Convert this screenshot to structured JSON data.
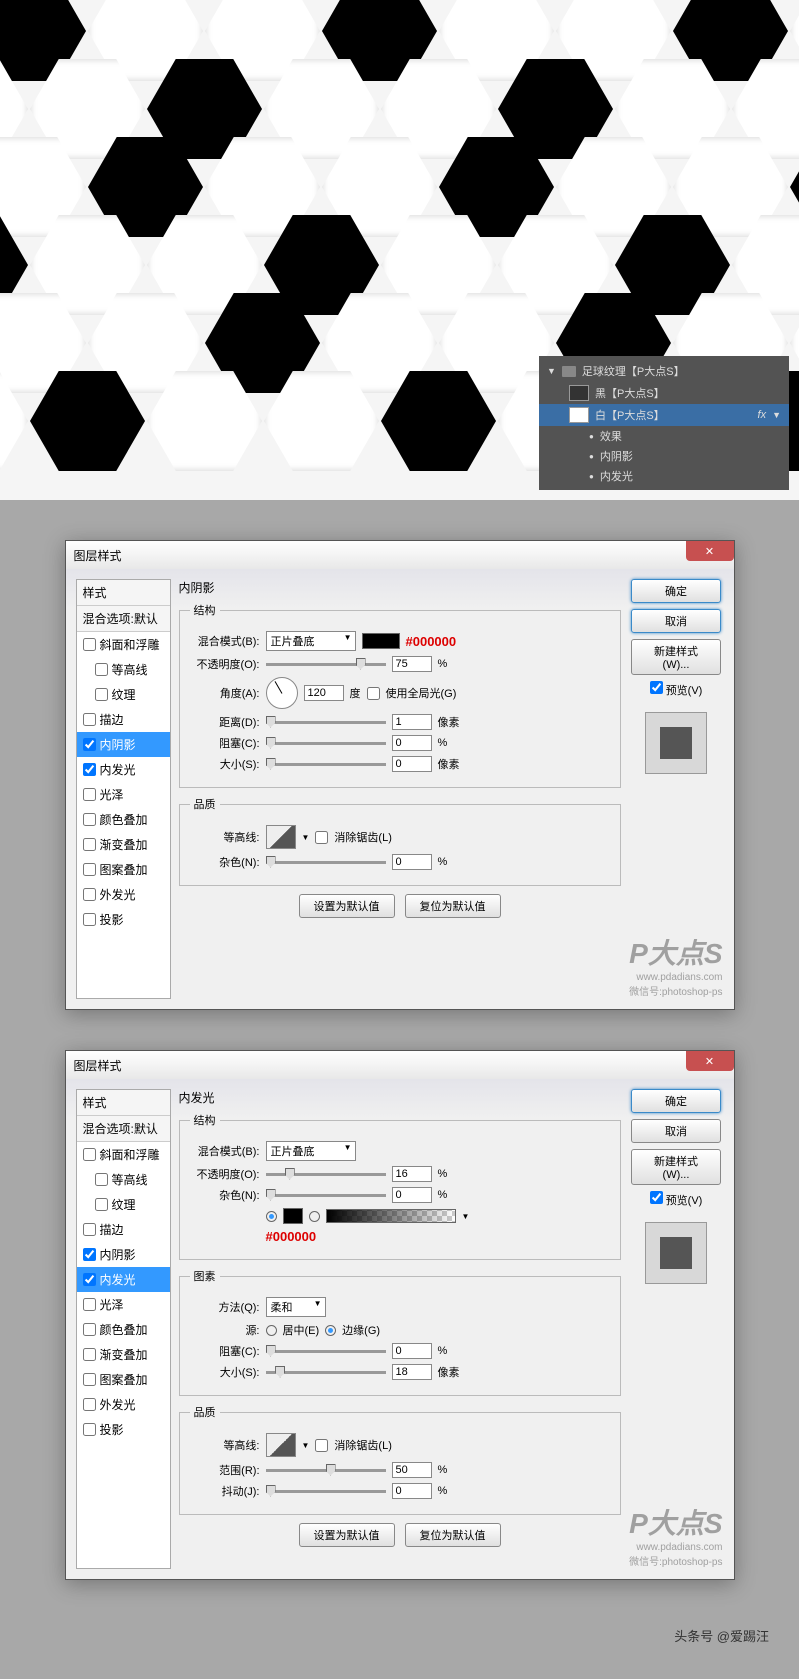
{
  "layers": {
    "group": "足球纹理【P大点S】",
    "black": "黑【P大点S】",
    "white": "白【P大点S】",
    "fx_label": "fx",
    "effects": "效果",
    "effect_inner_shadow": "内阴影",
    "effect_inner_glow": "内发光"
  },
  "dialog": {
    "title": "图层样式",
    "close": "✕",
    "ok": "确定",
    "cancel": "取消",
    "new_style": "新建样式(W)...",
    "preview": "预览(V)",
    "set_default": "设置为默认值",
    "reset_default": "复位为默认值"
  },
  "styles_list": {
    "header": "样式",
    "blend_default": "混合选项:默认",
    "bevel": "斜面和浮雕",
    "contour": "等高线",
    "texture": "纹理",
    "stroke": "描边",
    "inner_shadow": "内阴影",
    "inner_glow": "内发光",
    "satin": "光泽",
    "color_overlay": "颜色叠加",
    "gradient_overlay": "渐变叠加",
    "pattern_overlay": "图案叠加",
    "outer_glow": "外发光",
    "drop_shadow": "投影"
  },
  "d1": {
    "title": "内阴影",
    "structure": "结构",
    "blend_mode_label": "混合模式(B):",
    "blend_mode_value": "正片叠底",
    "color_hex": "#000000",
    "opacity_label": "不透明度(O):",
    "opacity_value": "75",
    "angle_label": "角度(A):",
    "angle_value": "120",
    "angle_unit": "度",
    "global_light": "使用全局光(G)",
    "distance_label": "距离(D):",
    "distance_value": "1",
    "px": "像素",
    "choke_label": "阻塞(C):",
    "choke_value": "0",
    "size_label": "大小(S):",
    "size_value": "0",
    "quality": "品质",
    "contour_label": "等高线:",
    "antialias": "消除锯齿(L)",
    "noise_label": "杂色(N):",
    "noise_value": "0",
    "pct": "%"
  },
  "d2": {
    "title": "内发光",
    "structure": "结构",
    "blend_mode_label": "混合模式(B):",
    "blend_mode_value": "正片叠底",
    "opacity_label": "不透明度(O):",
    "opacity_value": "16",
    "noise_label": "杂色(N):",
    "noise_value": "0",
    "color_hex": "#000000",
    "elements": "图素",
    "technique_label": "方法(Q):",
    "technique_value": "柔和",
    "source_label": "源:",
    "source_center": "居中(E)",
    "source_edge": "边缘(G)",
    "choke_label": "阻塞(C):",
    "choke_value": "0",
    "size_label": "大小(S):",
    "size_value": "18",
    "px": "像素",
    "quality": "品质",
    "contour_label": "等高线:",
    "antialias": "消除锯齿(L)",
    "range_label": "范围(R):",
    "range_value": "50",
    "jitter_label": "抖动(J):",
    "jitter_value": "0",
    "pct": "%"
  },
  "watermark": {
    "logo": "P大点S",
    "url": "www.pdadians.com",
    "wechat": "微信号:photoshop-ps"
  },
  "footer": "头条号 @爱踢汪"
}
